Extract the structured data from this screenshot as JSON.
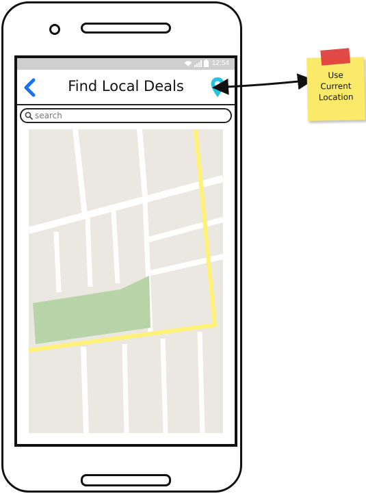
{
  "status_bar": {
    "time": "12:54"
  },
  "header": {
    "title": "Find Local Deals"
  },
  "search": {
    "placeholder": "search"
  },
  "annotation": {
    "lines": [
      "Use",
      "Current",
      "Location"
    ]
  },
  "icons": {
    "back": "chevron-left-icon",
    "location": "map-pin-icon",
    "search": "magnifier-icon"
  },
  "colors": {
    "accent": "#1a73e8",
    "pin": "#22c4e0",
    "road_major": "#fff176",
    "park": "#b7d4a8",
    "map_bg": "#ebe8e1",
    "note": "#fbe96a",
    "tape": "#e03a3a"
  }
}
